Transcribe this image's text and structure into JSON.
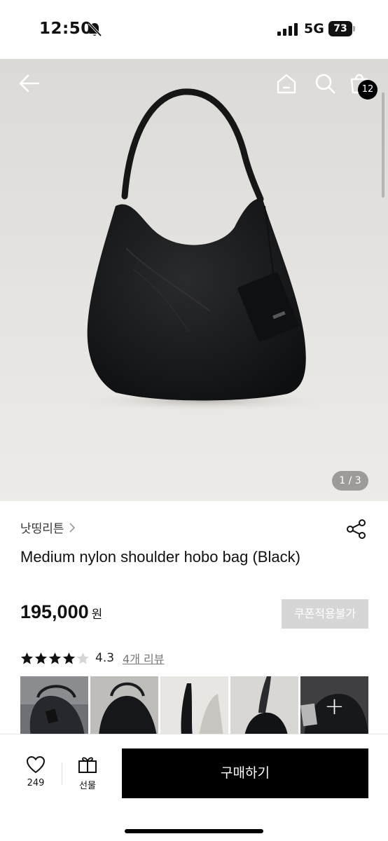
{
  "status_bar": {
    "time": "12:50",
    "network": "5G",
    "battery": "73"
  },
  "hero": {
    "page_indicator": "1 / 3",
    "cart_count": "12",
    "background_color": "#e3e1dd"
  },
  "icons": {
    "back": "arrow-left-icon",
    "home": "home-icon",
    "search": "search-icon",
    "cart": "shopping-bag-icon",
    "share": "share-icon",
    "like": "heart-icon",
    "gift": "gift-icon"
  },
  "product": {
    "seller": "낫띵리튼",
    "title": "Medium nylon shoulder hobo bag (Black)",
    "price": "195,000",
    "price_unit": "원",
    "coupon_label": "쿠폰적용불가"
  },
  "rating": {
    "value": "4.3",
    "stars": 4.3,
    "max_stars": 5,
    "review_link": "4개 리뷰"
  },
  "thumbnails": {
    "count": 5
  },
  "bottom_bar": {
    "like_count": "249",
    "gift_label": "선물",
    "buy_label": "구매하기"
  },
  "colors": {
    "primary": "#000000",
    "disabled": "#d6d6d6",
    "link": "#777777"
  }
}
